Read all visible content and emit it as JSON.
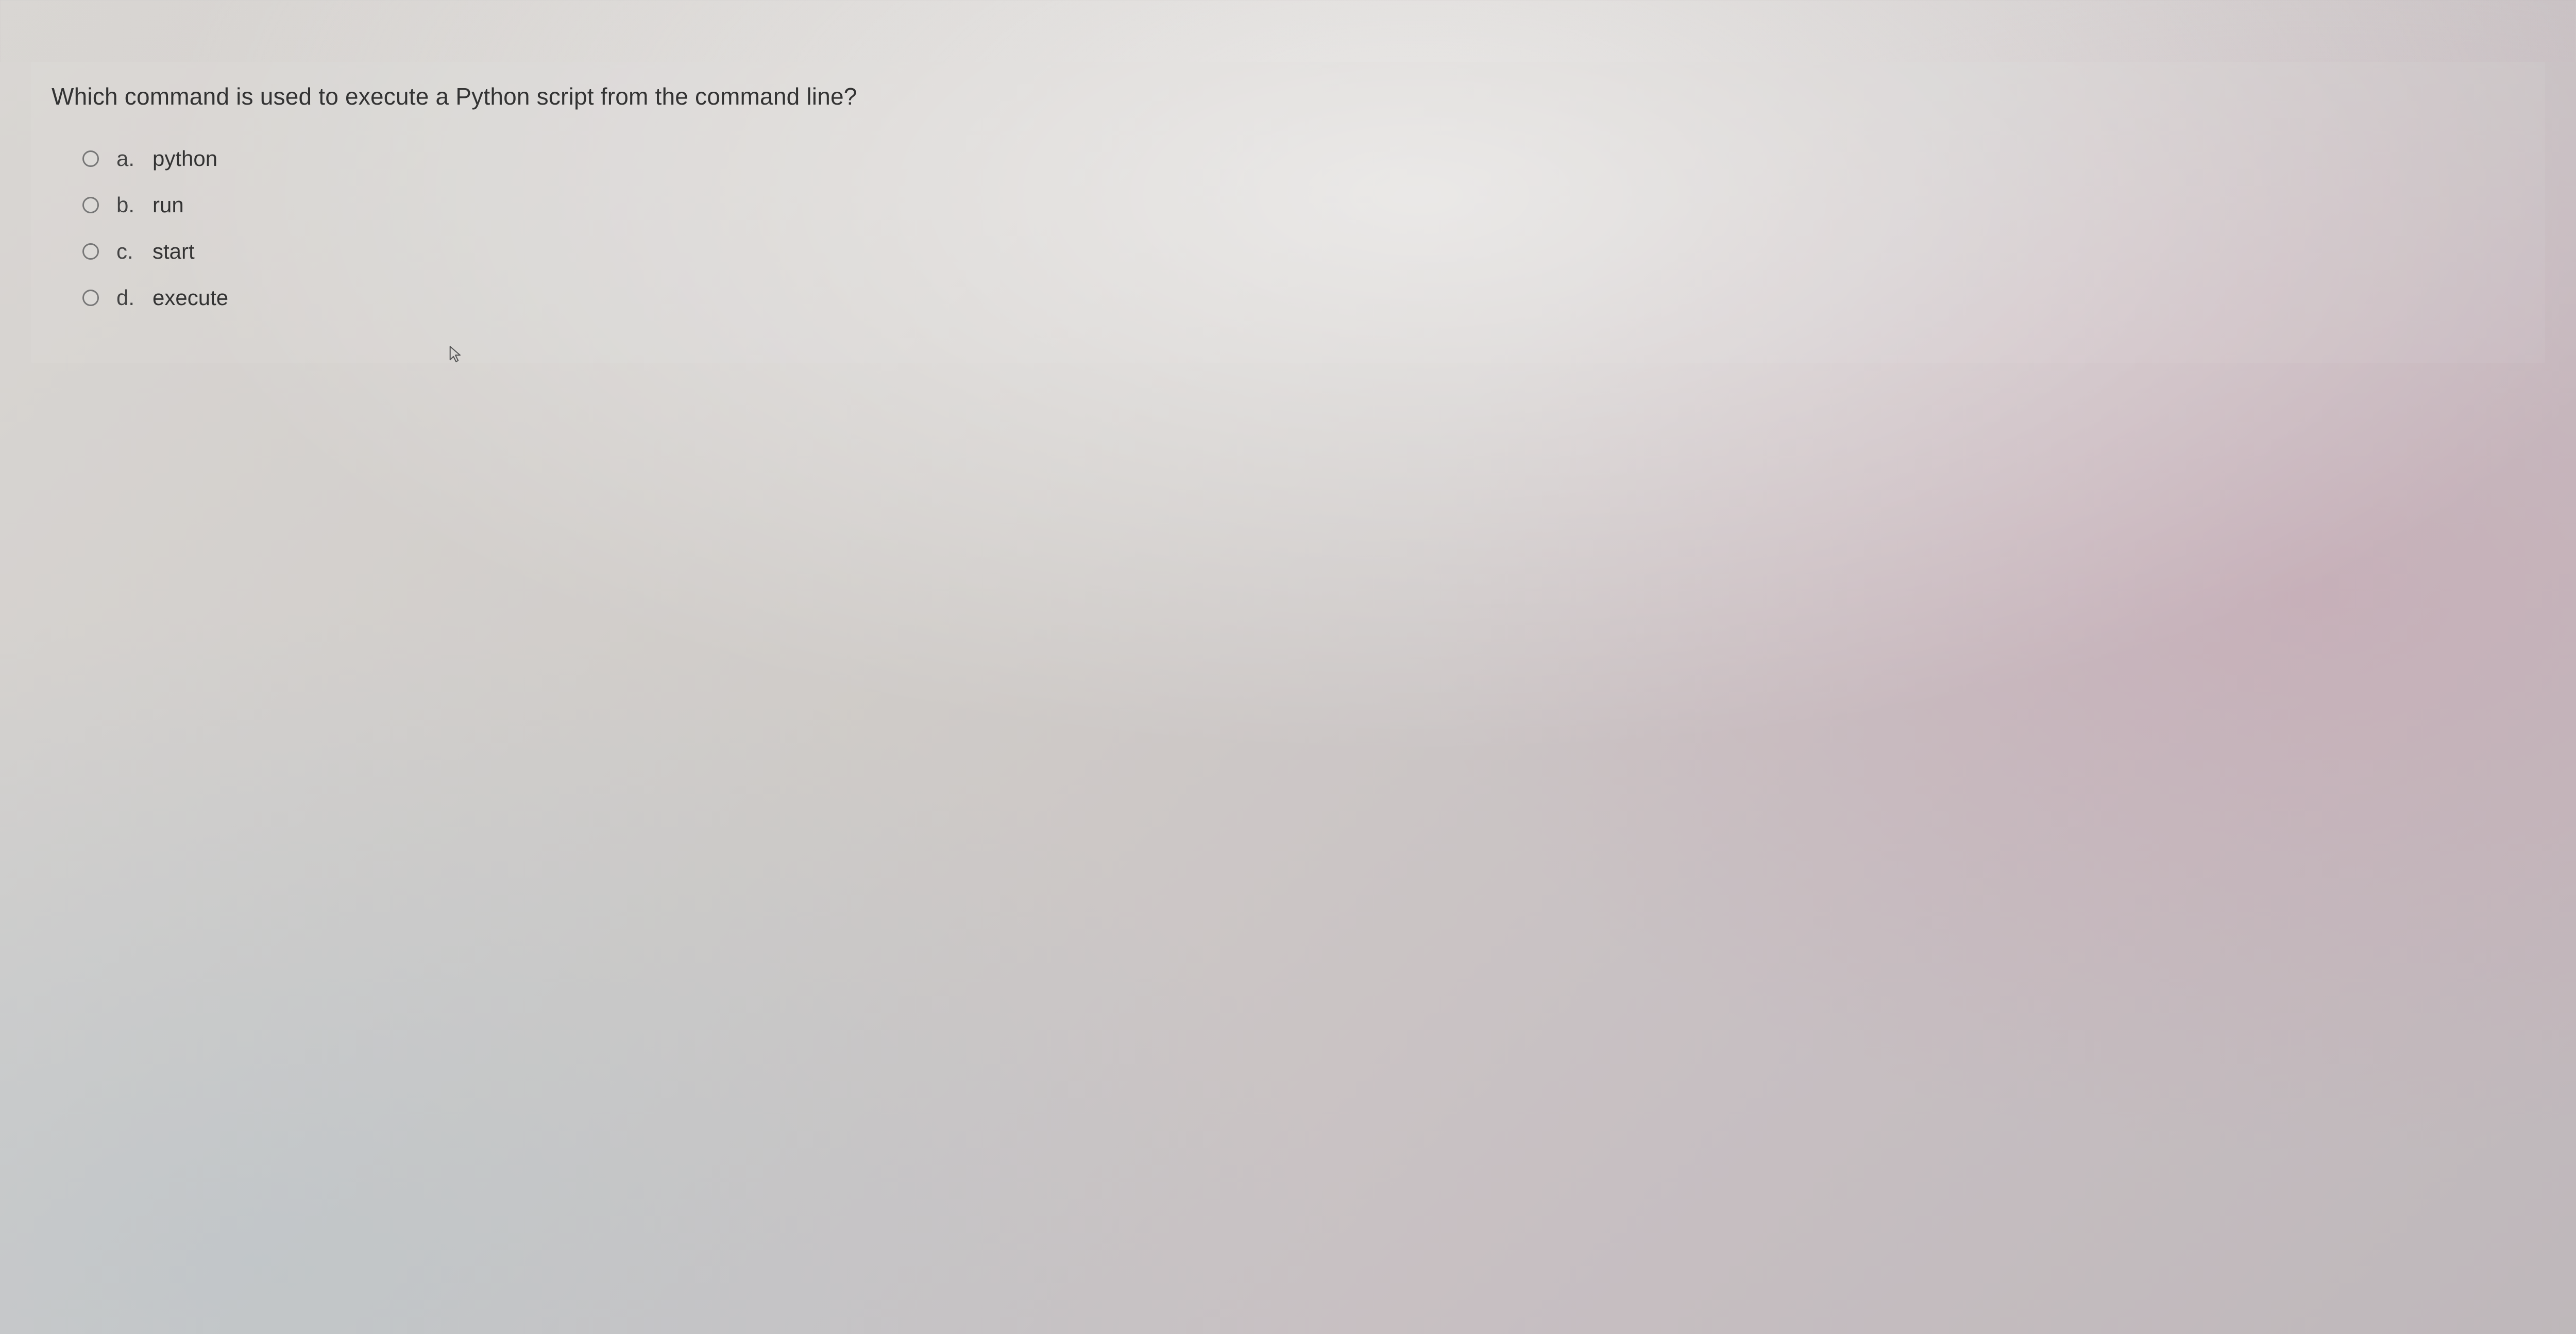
{
  "question": "Which command is used to execute a Python script from the command line?",
  "options": [
    {
      "letter": "a.",
      "text": "python"
    },
    {
      "letter": "b.",
      "text": "run"
    },
    {
      "letter": "c.",
      "text": "start"
    },
    {
      "letter": "d.",
      "text": "execute"
    }
  ]
}
